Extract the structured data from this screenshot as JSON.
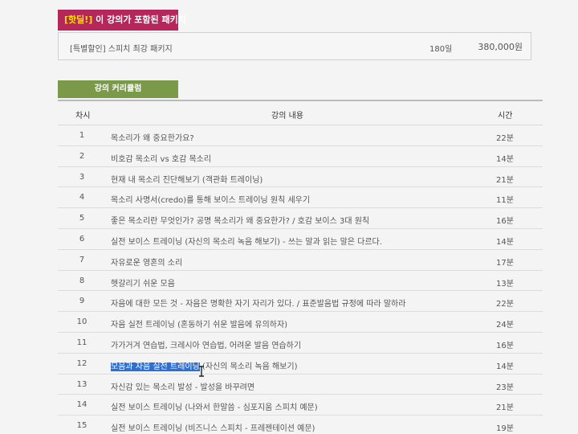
{
  "hot_deal": {
    "badge": "[핫딜!]",
    "title": " 이 강의가 포함된 패키지"
  },
  "package": {
    "name": "[특별할인] 스피치 최강 패키지",
    "days": "180일",
    "price": "380,000원"
  },
  "curriculum": {
    "header": "강의 커리큘럼",
    "columns": {
      "num": "차시",
      "title": "강의 내용",
      "time": "시간"
    },
    "rows": [
      {
        "num": "1",
        "title": "목소리가 왜 중요한가요?",
        "time": "22분"
      },
      {
        "num": "2",
        "title": "비호감 목소리 vs 호감 목소리",
        "time": "14분"
      },
      {
        "num": "3",
        "title": "현재 내 목소리 진단해보기 (객관화 트레이닝)",
        "time": "21분"
      },
      {
        "num": "4",
        "title": "목소리 사명서(credo)를 통해 보이스 트레이닝 원칙 세우기",
        "time": "11분"
      },
      {
        "num": "5",
        "title": "좋은 목소리란 무엇인가? 공명 목소리가 왜 중요한가? / 호감 보이스 3대 원칙",
        "time": "16분"
      },
      {
        "num": "6",
        "title": "실전 보이스 트레이닝 (자신의 목소리 녹음 해보기) - 쓰는 말과 읽는 말은 다르다.",
        "time": "14분"
      },
      {
        "num": "7",
        "title": "자유로운 영혼의 소리",
        "time": "17분"
      },
      {
        "num": "8",
        "title": "헷갈리기 쉬운 모음",
        "time": "13분"
      },
      {
        "num": "9",
        "title": "자음에 대한 모든 것 - 자음은 명확한 자기 자리가 있다. / 표준발음법 규정에 따라 말하라",
        "time": "22분"
      },
      {
        "num": "10",
        "title": "자음 실전 트레이닝 (혼동하기 쉬운 발음에 유의하자)",
        "time": "24분"
      },
      {
        "num": "11",
        "title": "가가거겨 연습법, 크레시아 연습법, 어려운 발음 연습하기",
        "time": "16분"
      },
      {
        "num": "12",
        "title_selected": "모음과 자음 실전 트레이닝",
        "title_rest": " (자신의 목소리 녹음 해보기)",
        "time": "14분"
      },
      {
        "num": "13",
        "title": "자신감 있는 목소리 발성 - 발성을 바꾸려면",
        "time": "23분"
      },
      {
        "num": "14",
        "title": "실전 보이스 트레이닝 (나와서 한말씀 - 심포지움 스피치 예문)",
        "time": "21분"
      },
      {
        "num": "15",
        "title": "실전 보이스 트레이닝 (비즈니스 스피치 - 프레젠테이션 예문)",
        "time": "19분"
      }
    ]
  },
  "colors": {
    "hot_badge_bg": "#b5275a",
    "hot_badge_text": "#ffe000",
    "curriculum_bg": "#7a9a4a",
    "selection": "#2f6fd0"
  },
  "cursor_icon": "text-cursor-icon"
}
